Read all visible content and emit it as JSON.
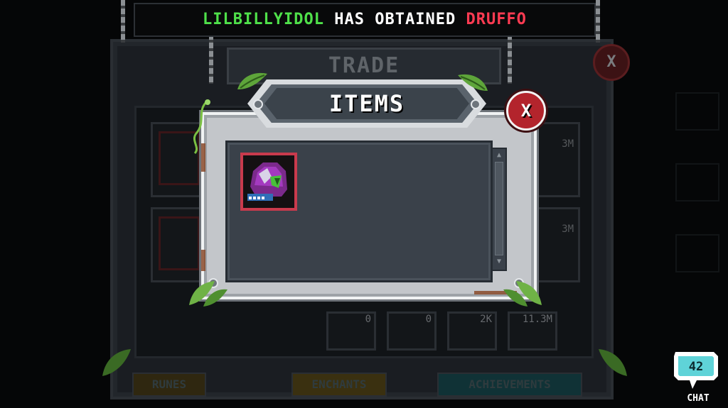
{
  "banner": {
    "player": "LILBILLYIDOL",
    "middle": "HAS OBTAINED",
    "item": "DRUFFO",
    "colors": {
      "player": "#4fe04a",
      "middle": "#ffffff",
      "item": "#ff3b52"
    }
  },
  "background": {
    "title": "TRADE",
    "close_label": "X",
    "bottom_slots": [
      "0",
      "0",
      "2K",
      "11.3M"
    ],
    "tabs": [
      "RUNES",
      "ENCHANTS",
      "ACHIEVEMENTS"
    ],
    "right_values": [
      "3M",
      "M",
      "3M"
    ]
  },
  "modal": {
    "title": "ITEMS",
    "close_label": "X",
    "items": [
      {
        "name": "druffo",
        "icon": "druffo-helmet-icon"
      }
    ]
  },
  "chat": {
    "count": "42",
    "label": "CHAT"
  },
  "colors": {
    "accent_red": "#c93a4d",
    "modal_frame": "#c3c6ca",
    "list_bg": "#3a414a"
  }
}
